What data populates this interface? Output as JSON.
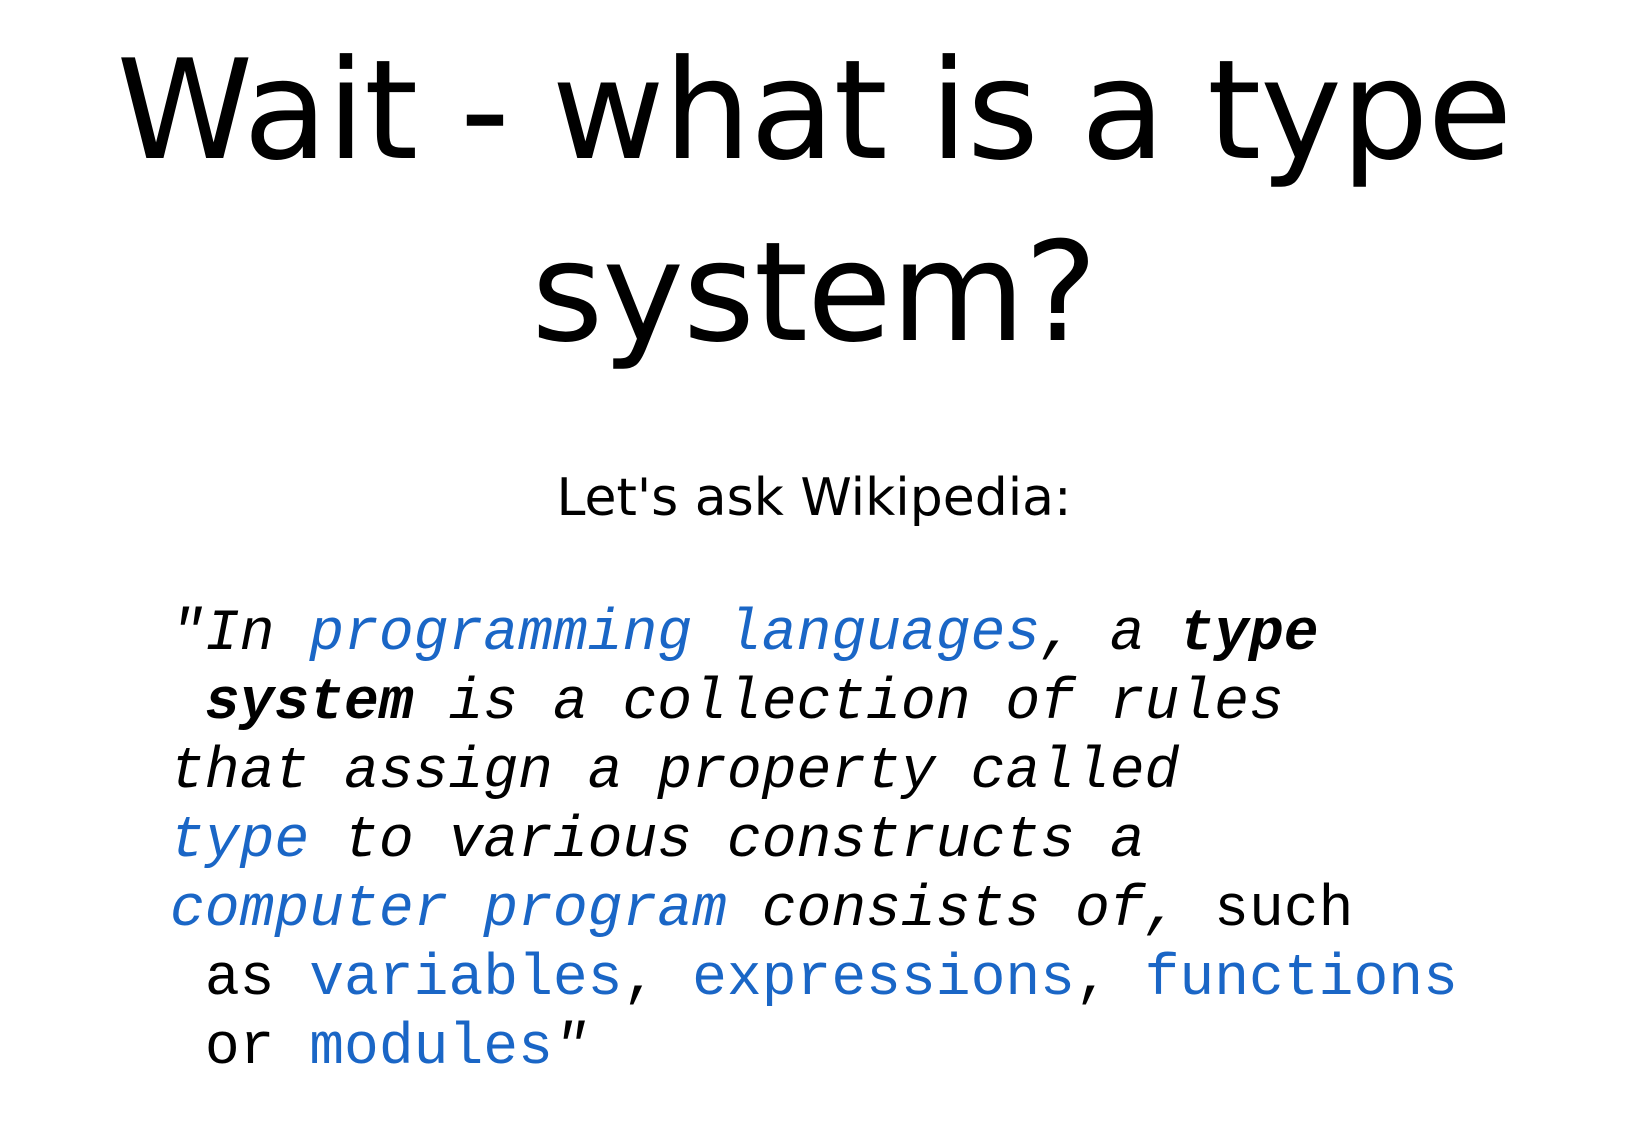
{
  "slide": {
    "title_line1": "Wait - what is a type",
    "title_line2": "system?",
    "subtitle": "Let's ask Wikipedia:",
    "quote": {
      "l1_open": "\"In ",
      "l1_link": "programming languages",
      "l1_mid": ", a ",
      "l1_bold": "type",
      "l2_bold": "system",
      "l2_rest": " is a collection of rules",
      "l3": "that assign a property called",
      "l4_link": "type",
      "l4_rest": " to various constructs a",
      "l5_link": "computer program",
      "l5_rest": " consists of,",
      "l5_plain": " such",
      "l6_plain": "as ",
      "l6_link1": "variables",
      "l6_sep1": ", ",
      "l6_link2": "expressions",
      "l6_sep2": ", ",
      "l6_link3": "functions",
      "l7_plain": "or ",
      "l7_link": "modules",
      "l7_close": "\""
    }
  },
  "colors": {
    "text": "#000000",
    "link": "#1a66c6",
    "background": "#ffffff"
  }
}
